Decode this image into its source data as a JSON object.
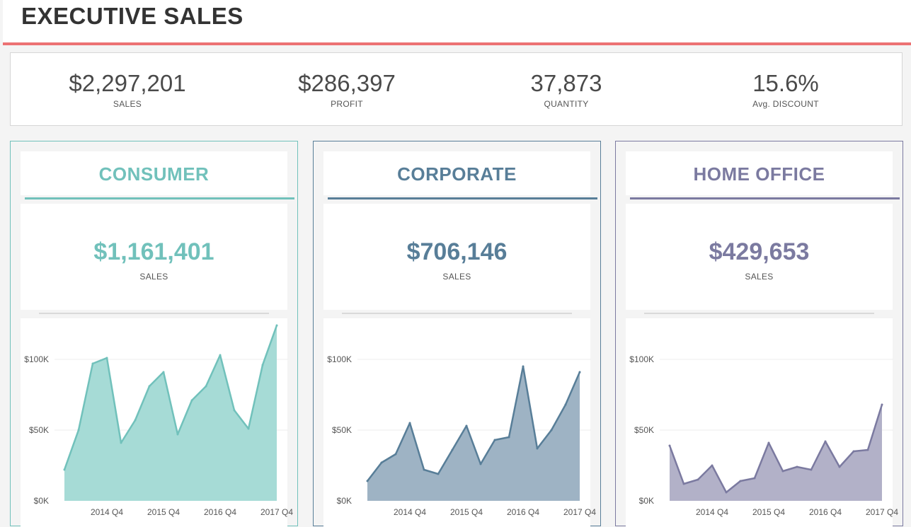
{
  "header": {
    "title": "EXECUTIVE SALES"
  },
  "kpis": [
    {
      "value": "$2,297,201",
      "label": "SALES"
    },
    {
      "value": "$286,397",
      "label": "PROFIT"
    },
    {
      "value": "37,873",
      "label": "QUANTITY"
    },
    {
      "value": "15.6%",
      "label": "Avg. DISCOUNT"
    }
  ],
  "segments": [
    {
      "name": "CONSUMER",
      "sales": "$1,161,401",
      "sales_label": "SALES",
      "color": "#71c1bb",
      "fill": "#a6dbd6"
    },
    {
      "name": "CORPORATE",
      "sales": "$706,146",
      "sales_label": "SALES",
      "color": "#587e98",
      "fill": "#9eb3c4"
    },
    {
      "name": "HOME OFFICE",
      "sales": "$429,653",
      "sales_label": "SALES",
      "color": "#7b7aa0",
      "fill": "#b2b1c8"
    }
  ],
  "chart_data": [
    {
      "type": "area",
      "x": [
        "2014 Q1",
        "2014 Q2",
        "2014 Q3",
        "2014 Q4",
        "2015 Q1",
        "2015 Q2",
        "2015 Q3",
        "2015 Q4",
        "2016 Q1",
        "2016 Q2",
        "2016 Q3",
        "2016 Q4",
        "2017 Q1",
        "2017 Q2",
        "2017 Q3",
        "2017 Q4"
      ],
      "x_tick_labels": [
        "2014 Q4",
        "2015 Q4",
        "2016 Q4",
        "2017 Q4"
      ],
      "y_tick_labels": [
        "$100K",
        "$50K",
        "$0K"
      ],
      "ylim": [
        0,
        125000
      ],
      "series": [
        {
          "values": [
            22000,
            50000,
            97000,
            101000,
            41000,
            57000,
            81000,
            91000,
            47000,
            71000,
            81000,
            103000,
            64000,
            51000,
            96000,
            124000
          ]
        }
      ]
    },
    {
      "type": "area",
      "x": [
        "2014 Q1",
        "2014 Q2",
        "2014 Q3",
        "2014 Q4",
        "2015 Q1",
        "2015 Q2",
        "2015 Q3",
        "2015 Q4",
        "2016 Q1",
        "2016 Q2",
        "2016 Q3",
        "2016 Q4",
        "2017 Q1",
        "2017 Q2",
        "2017 Q3",
        "2017 Q4"
      ],
      "x_tick_labels": [
        "2014 Q4",
        "2015 Q4",
        "2016 Q4",
        "2017 Q4"
      ],
      "y_tick_labels": [
        "$100K",
        "$50K",
        "$0K"
      ],
      "ylim": [
        0,
        125000
      ],
      "series": [
        {
          "values": [
            14000,
            27000,
            33000,
            55000,
            22000,
            19000,
            36000,
            53000,
            26000,
            43000,
            45000,
            95000,
            37000,
            50000,
            68000,
            91000
          ]
        }
      ]
    },
    {
      "type": "area",
      "x": [
        "2014 Q1",
        "2014 Q2",
        "2014 Q3",
        "2014 Q4",
        "2015 Q1",
        "2015 Q2",
        "2015 Q3",
        "2015 Q4",
        "2016 Q1",
        "2016 Q2",
        "2016 Q3",
        "2016 Q4",
        "2017 Q1",
        "2017 Q2",
        "2017 Q3",
        "2017 Q4"
      ],
      "x_tick_labels": [
        "2014 Q4",
        "2015 Q4",
        "2016 Q4",
        "2017 Q4"
      ],
      "y_tick_labels": [
        "$100K",
        "$50K",
        "$0K"
      ],
      "ylim": [
        0,
        125000
      ],
      "series": [
        {
          "values": [
            39000,
            12000,
            15000,
            25000,
            6000,
            14000,
            16000,
            41000,
            21000,
            24000,
            22000,
            42000,
            24000,
            35000,
            36000,
            68000
          ]
        }
      ]
    }
  ]
}
